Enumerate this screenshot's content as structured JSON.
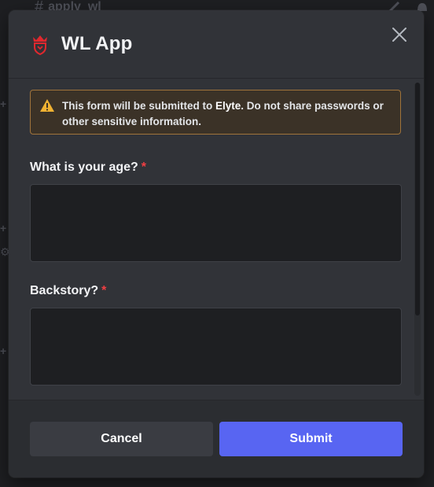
{
  "background": {
    "channel_name": "apply_wl",
    "channel_icon": "hash-icon"
  },
  "modal": {
    "title": "WL App",
    "app_icon": "crown-shield-icon",
    "close_icon": "close-icon",
    "warning": {
      "icon": "warning-icon",
      "text_before": "This form will be submitted to ",
      "brand": "Elyte",
      "text_after": ". Do not share passwords or other sensitive information."
    },
    "fields": [
      {
        "label": "What is your age?",
        "required_marker": "*",
        "value": ""
      },
      {
        "label": "Backstory?",
        "required_marker": "*",
        "value": ""
      }
    ],
    "footer": {
      "cancel_label": "Cancel",
      "submit_label": "Submit"
    }
  },
  "colors": {
    "accent": "#5865f2",
    "warning_border": "#a0743b",
    "required": "#f23f43",
    "app_icon": "#e0282e"
  }
}
